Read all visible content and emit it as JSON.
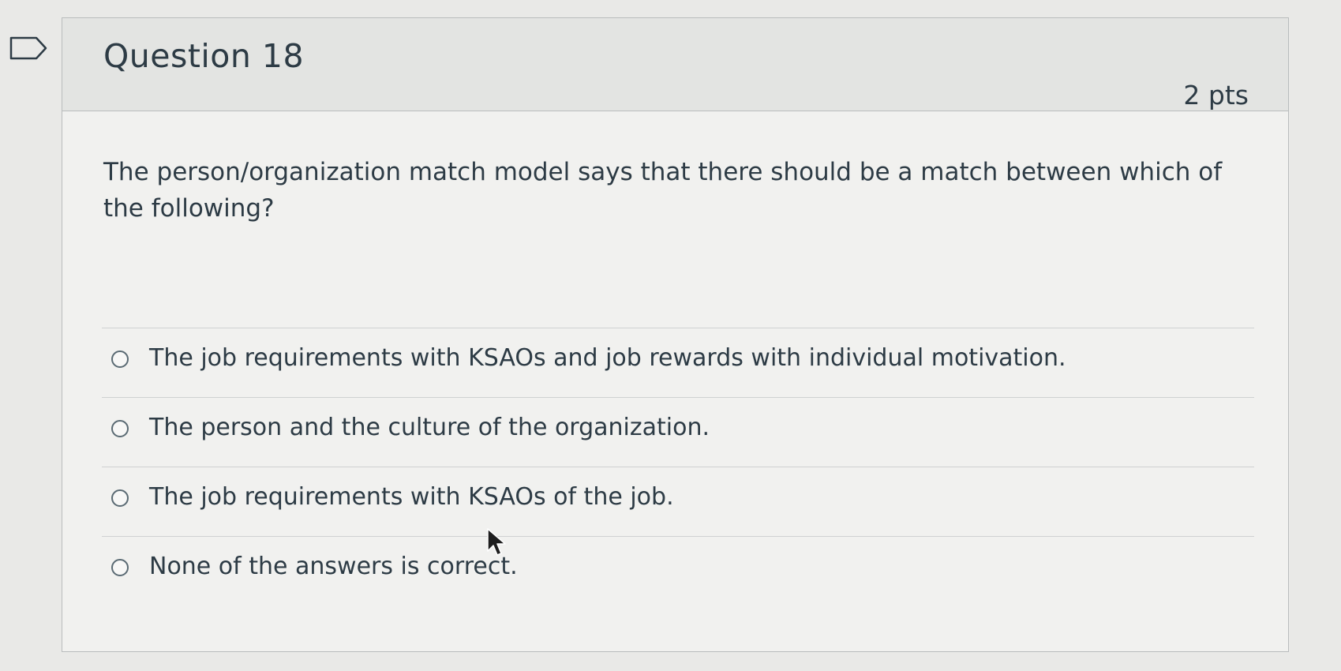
{
  "question": {
    "title": "Question 18",
    "points": "2 pts",
    "text": "The person/organization match model says that there should be a match between which of the following?",
    "flag_icon": "flag-outline-icon"
  },
  "answers": [
    {
      "label": "The job requirements with KSAOs and job rewards with individual motivation.",
      "selected": false
    },
    {
      "label": "The person and the culture of the organization.",
      "selected": false
    },
    {
      "label": "The job requirements with KSAOs of the job.",
      "selected": false
    },
    {
      "label": "None of the answers is correct.",
      "selected": false
    }
  ],
  "colors": {
    "text": "#2d3b45",
    "header_bg": "#e3e4e2",
    "border": "#b9bcbd"
  }
}
